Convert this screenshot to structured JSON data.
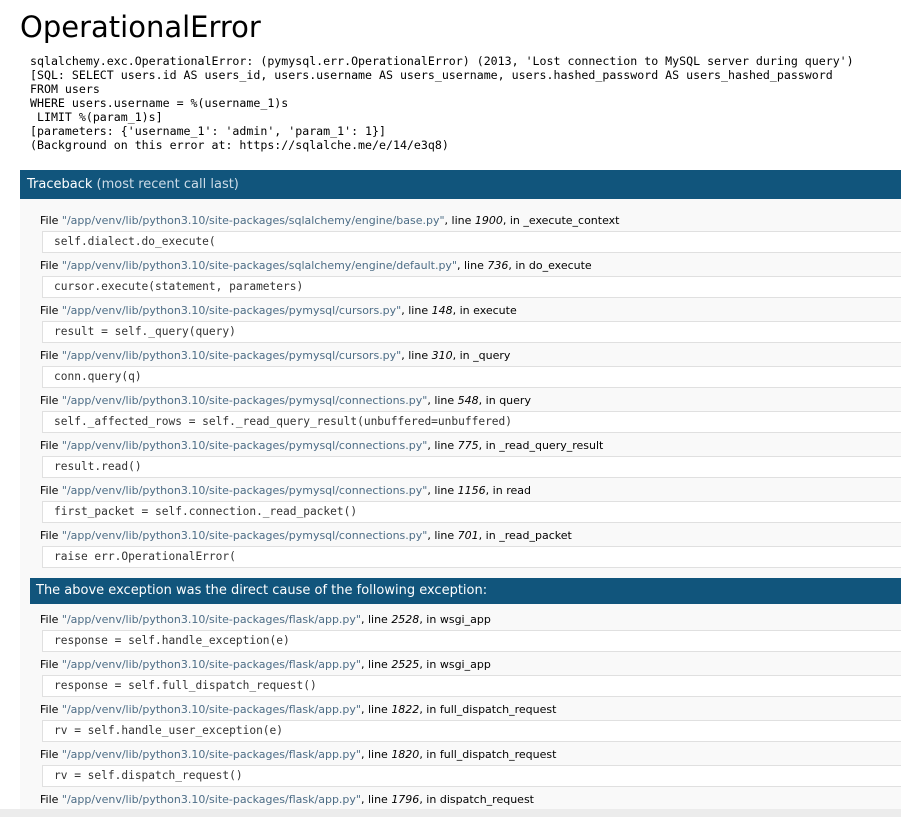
{
  "title": "OperationalError",
  "error_lines": [
    "sqlalchemy.exc.OperationalError: (pymysql.err.OperationalError) (2013, 'Lost connection to MySQL server during query')",
    "[SQL: SELECT users.id AS users_id, users.username AS users_username, users.hashed_password AS users_hashed_password",
    "FROM users",
    "WHERE users.username = %(username_1)s",
    " LIMIT %(param_1)s]",
    "[parameters: {'username_1': 'admin', 'param_1': 1}]",
    "(Background on this error at: https://sqlalche.me/e/14/e3q8)"
  ],
  "traceback": {
    "title": "Traceback",
    "subtitle": "(most recent call last)"
  },
  "frames": [
    {
      "file": "\"/app/venv/lib/python3.10/site-packages/sqlalchemy/engine/base.py\"",
      "line": "1900",
      "func": "_execute_context",
      "code": "self.dialect.do_execute("
    },
    {
      "file": "\"/app/venv/lib/python3.10/site-packages/sqlalchemy/engine/default.py\"",
      "line": "736",
      "func": "do_execute",
      "code": "cursor.execute(statement, parameters)"
    },
    {
      "file": "\"/app/venv/lib/python3.10/site-packages/pymysql/cursors.py\"",
      "line": "148",
      "func": "execute",
      "code": "result = self._query(query)"
    },
    {
      "file": "\"/app/venv/lib/python3.10/site-packages/pymysql/cursors.py\"",
      "line": "310",
      "func": "_query",
      "code": "conn.query(q)"
    },
    {
      "file": "\"/app/venv/lib/python3.10/site-packages/pymysql/connections.py\"",
      "line": "548",
      "func": "query",
      "code": "self._affected_rows = self._read_query_result(unbuffered=unbuffered)"
    },
    {
      "file": "\"/app/venv/lib/python3.10/site-packages/pymysql/connections.py\"",
      "line": "775",
      "func": "_read_query_result",
      "code": "result.read()"
    },
    {
      "file": "\"/app/venv/lib/python3.10/site-packages/pymysql/connections.py\"",
      "line": "1156",
      "func": "read",
      "code": "first_packet = self.connection._read_packet()"
    },
    {
      "file": "\"/app/venv/lib/python3.10/site-packages/pymysql/connections.py\"",
      "line": "701",
      "func": "_read_packet",
      "code": "raise err.OperationalError("
    }
  ],
  "cause_text": "The above exception was the direct cause of the following exception:",
  "frames2": [
    {
      "file": "\"/app/venv/lib/python3.10/site-packages/flask/app.py\"",
      "line": "2528",
      "func": "wsgi_app",
      "code": "response = self.handle_exception(e)"
    },
    {
      "file": "\"/app/venv/lib/python3.10/site-packages/flask/app.py\"",
      "line": "2525",
      "func": "wsgi_app",
      "code": "response = self.full_dispatch_request()"
    },
    {
      "file": "\"/app/venv/lib/python3.10/site-packages/flask/app.py\"",
      "line": "1822",
      "func": "full_dispatch_request",
      "code": "rv = self.handle_user_exception(e)"
    },
    {
      "file": "\"/app/venv/lib/python3.10/site-packages/flask/app.py\"",
      "line": "1820",
      "func": "full_dispatch_request",
      "code": "rv = self.dispatch_request()"
    },
    {
      "file": "\"/app/venv/lib/python3.10/site-packages/flask/app.py\"",
      "line": "1796",
      "func": "dispatch_request",
      "code": ""
    }
  ],
  "labels": {
    "file_prefix": "File ",
    "line_prefix": ", line ",
    "in_prefix": ", in "
  }
}
